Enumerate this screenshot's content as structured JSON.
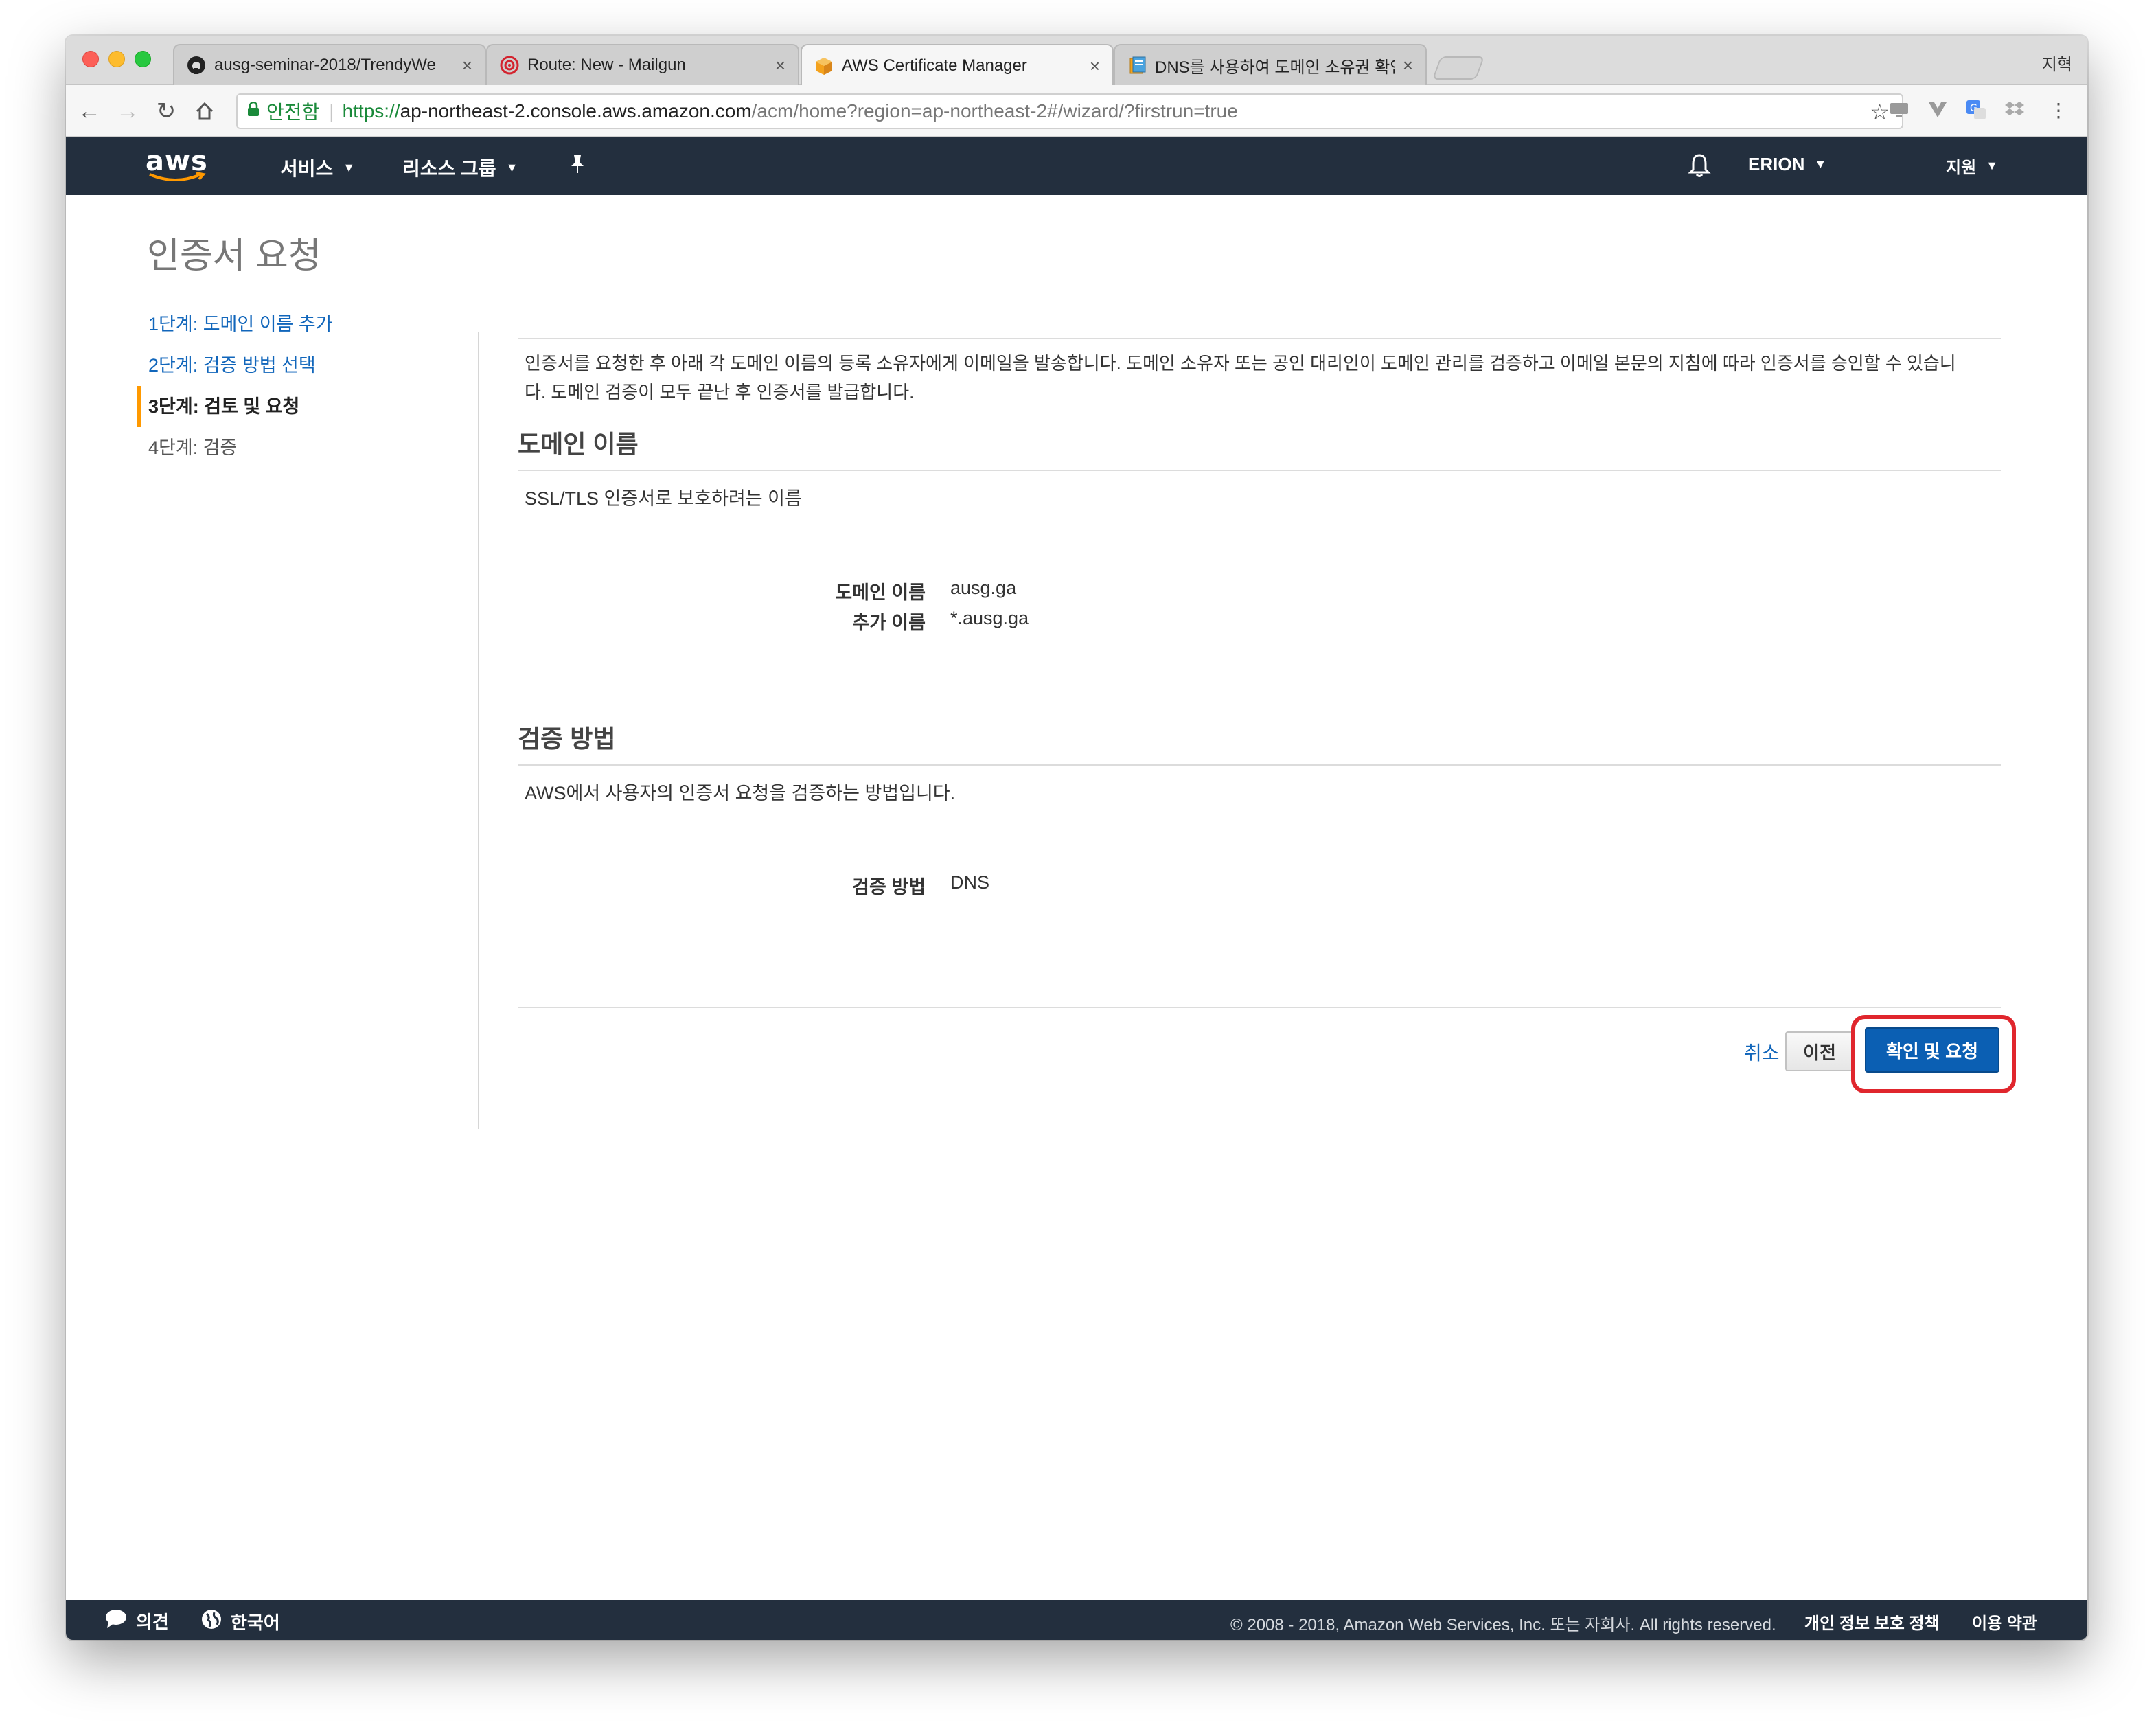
{
  "browser": {
    "tabs": [
      {
        "title": "ausg-seminar-2018/TrendyWe",
        "favicon": "github-icon",
        "active": false
      },
      {
        "title": "Route: New - Mailgun",
        "favicon": "mailgun-icon",
        "active": false
      },
      {
        "title": "AWS Certificate Manager",
        "favicon": "aws-icon",
        "active": true
      },
      {
        "title": "DNS를 사용하여 도메인 소유권 확인",
        "favicon": "docs-icon",
        "active": false
      }
    ],
    "tab_close": "×",
    "profile_name": "지혁",
    "address": {
      "secure_label": "안전함",
      "url_scheme": "https://",
      "url_host": "ap-northeast-2.console.aws.amazon.com",
      "url_path": "/acm/home?region=ap-northeast-2#/wizard/?firstrun=true"
    }
  },
  "aws_nav": {
    "logo_text": "aws",
    "services": "서비스",
    "resource_groups": "리소스 그룹",
    "account": "ERION",
    "support": "지원"
  },
  "page": {
    "title": "인증서 요청",
    "steps": [
      {
        "label": "1단계: 도메인 이름 추가",
        "state": "link"
      },
      {
        "label": "2단계: 검증 방법 선택",
        "state": "link"
      },
      {
        "label": "3단계: 검토 및 요청",
        "state": "current"
      },
      {
        "label": "4단계: 검증",
        "state": "future"
      }
    ],
    "intro_line1": "인증서를 요청한 후 아래 각 도메인 이름의 등록 소유자에게 이메일을 발송합니다. 도메인 소유자 또는 공인 대리인이 도메인 관리를 검증하고 이메일 본문의 지침에 따라 인증서를 승인할 수 있습니",
    "intro_line2": "다. 도메인 검증이 모두 끝난 후 인증서를 발급합니다.",
    "domain_section": {
      "heading": "도메인 이름",
      "description": "SSL/TLS 인증서로 보호하려는 이름",
      "domain_label": "도메인 이름",
      "domain_value": "ausg.ga",
      "additional_label": "추가 이름",
      "additional_value": "*.ausg.ga"
    },
    "validation_section": {
      "heading": "검증 방법",
      "description": "AWS에서 사용자의 인증서 요청을 검증하는 방법입니다.",
      "method_label": "검증 방법",
      "method_value": "DNS"
    },
    "actions": {
      "cancel": "취소",
      "previous": "이전",
      "confirm": "확인 및 요청"
    }
  },
  "footer": {
    "feedback": "의견",
    "language": "한국어",
    "copyright": "© 2008 - 2018, Amazon Web Services, Inc. 또는 자회사. All rights reserved.",
    "privacy": "개인 정보 보호 정책",
    "terms": "이용 약관"
  },
  "colors": {
    "aws_nav_bg": "#232f3e",
    "accent_orange": "#ff9900",
    "primary_button": "#0b5fb3",
    "link": "#1166bb",
    "highlight_red": "#e0262d"
  }
}
